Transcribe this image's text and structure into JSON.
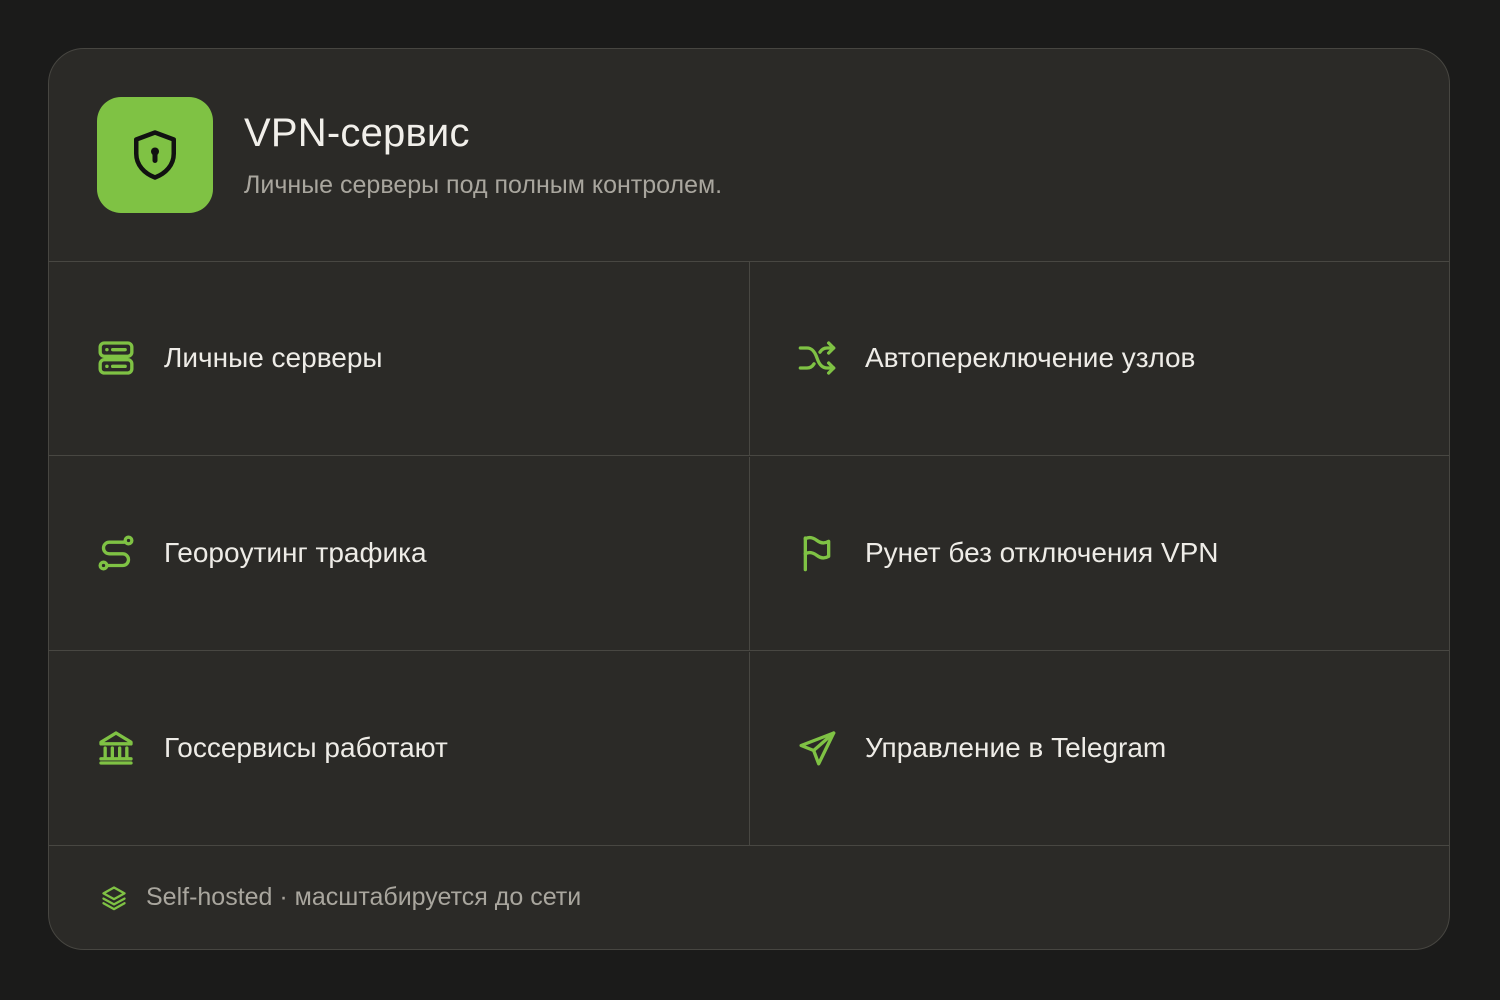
{
  "header": {
    "icon": "shield-lock-icon",
    "title": "VPN-сервис",
    "subtitle": "Личные серверы под полным контролем."
  },
  "features": [
    {
      "label": "Личные серверы",
      "icon": "server-icon"
    },
    {
      "label": "Автопереключение узлов",
      "icon": "shuffle-icon"
    },
    {
      "label": "Георoутинг трафика",
      "icon": "route-icon"
    },
    {
      "label": "Рунет без отключения VPN",
      "icon": "flag-icon"
    },
    {
      "label": "Госсервисы работают",
      "icon": "bank-icon"
    },
    {
      "label": "Управление в Telegram",
      "icon": "send-icon"
    }
  ],
  "footer": {
    "icon": "layers-icon",
    "text": "Self-hosted · масштабируется до сети"
  },
  "colors": {
    "accent": "#7fc244",
    "background": "#1b1b1a",
    "card": "#2b2a27",
    "divider": "#484742",
    "text_primary": "#eeece7",
    "text_secondary": "#a9a69e"
  }
}
